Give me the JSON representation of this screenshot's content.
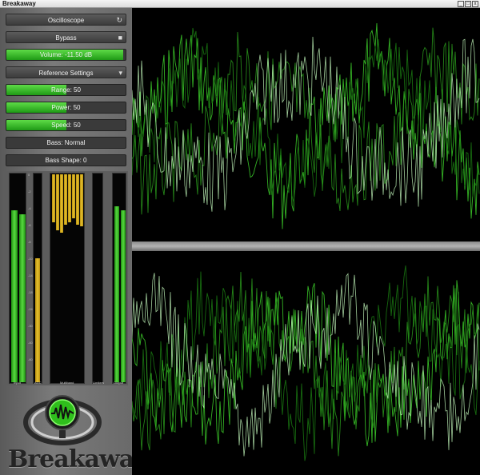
{
  "window": {
    "title": "Breakaway"
  },
  "controls": {
    "oscilloscope": {
      "label": "Oscilloscope",
      "icon": "refresh-icon"
    },
    "bypass": {
      "label": "Bypass",
      "icon": "square-icon"
    },
    "volume": {
      "label": "Volume: -11.50 dB",
      "fill": 0.98
    },
    "reference": {
      "label": "Reference Settings",
      "icon": "caret-down-icon"
    },
    "range": {
      "label": "Range: 50",
      "fill": 0.5
    },
    "power": {
      "label": "Power: 50",
      "fill": 0.5
    },
    "speed": {
      "label": "Speed: 50",
      "fill": 0.5
    },
    "bass": {
      "label": "Bass: Normal",
      "fill": 0.0
    },
    "bass_shape": {
      "label": "Bass Shape: 0",
      "fill": 0.0
    }
  },
  "meters": {
    "input": {
      "label": "Input",
      "levels": [
        0.86,
        0.84
      ]
    },
    "agc": {
      "label": "AGC",
      "level": 0.62
    },
    "multiband": {
      "label": "Multiband",
      "levels": [
        0.88,
        0.84,
        0.83,
        0.87,
        0.88,
        0.9,
        0.87,
        0.86
      ]
    },
    "limiters": {
      "label": "Limiters",
      "level": 0.0
    },
    "output": {
      "label": "Output",
      "levels": [
        0.88,
        0.86
      ]
    },
    "scale_marks": [
      "0",
      "-2",
      "-4",
      "-6",
      "-8",
      "-10",
      "-14",
      "-18",
      "-24",
      "-30",
      "-40",
      "-60"
    ]
  },
  "brand": {
    "name": "Breakaway",
    "accent_green": "#2ec81e",
    "gold": "#e0b820"
  },
  "scope": {
    "trace_color": "#3dd12a",
    "highlight_color": "#c8ffc0"
  }
}
